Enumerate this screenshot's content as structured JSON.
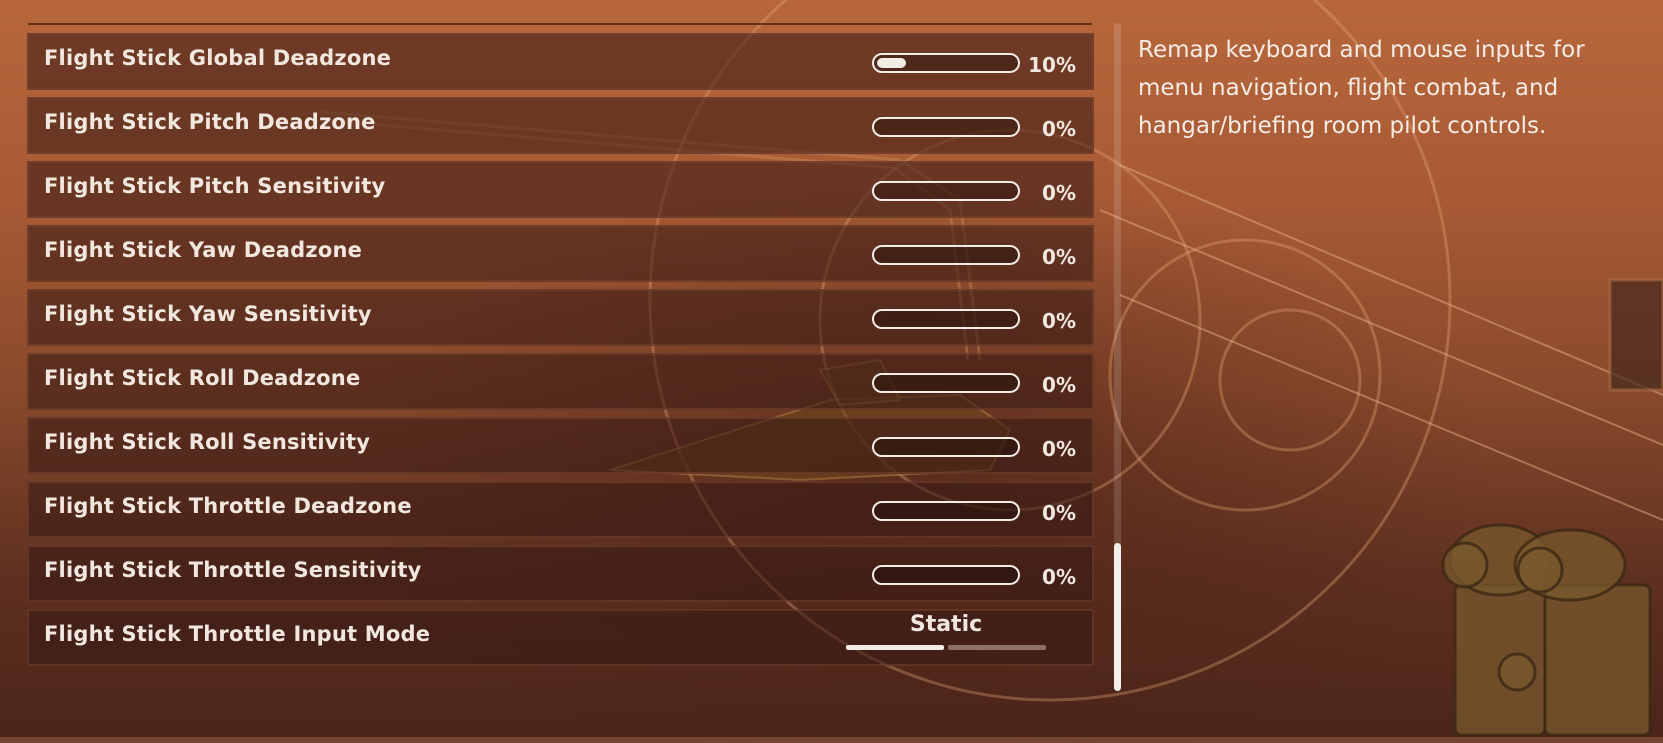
{
  "settings": [
    {
      "label": "Flight Stick Global Deadzone",
      "value": "10%",
      "fill": 0.1
    },
    {
      "label": "Flight Stick Pitch Deadzone",
      "value": "0%",
      "fill": 0
    },
    {
      "label": "Flight Stick Pitch Sensitivity",
      "value": "0%",
      "fill": 0
    },
    {
      "label": "Flight Stick Yaw Deadzone",
      "value": "0%",
      "fill": 0
    },
    {
      "label": "Flight Stick Yaw Sensitivity",
      "value": "0%",
      "fill": 0
    },
    {
      "label": "Flight Stick Roll Deadzone",
      "value": "0%",
      "fill": 0
    },
    {
      "label": "Flight Stick Roll Sensitivity",
      "value": "0%",
      "fill": 0
    },
    {
      "label": "Flight Stick Throttle Deadzone",
      "value": "0%",
      "fill": 0
    },
    {
      "label": "Flight Stick Throttle Sensitivity",
      "value": "0%",
      "fill": 0
    }
  ],
  "throttle_mode": {
    "label": "Flight Stick Throttle Input Mode",
    "value": "Static",
    "option_count": 2,
    "selected_index": 0
  },
  "description": "Remap keyboard and mouse inputs for menu navigation, flight combat, and hangar/briefing room pilot controls.",
  "colors": {
    "accent": "#f2ece6",
    "background": "#a65934",
    "row_background": "#34181488"
  }
}
